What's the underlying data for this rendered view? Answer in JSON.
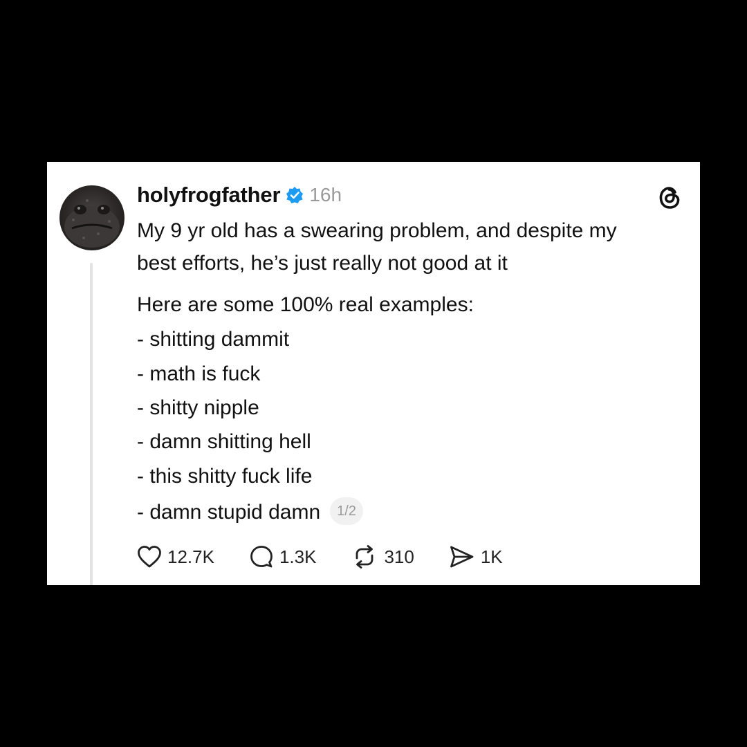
{
  "post": {
    "username": "holyfrogfather",
    "timestamp": "16h",
    "verified": true,
    "avatar_icon": "frog-avatar",
    "app_icon": "threads-logo-icon",
    "text_line1": "My 9 yr old has a swearing problem, and despite my",
    "text_line2": "best efforts, he’s just really not good at it",
    "intro": "Here are some 100% real examples:",
    "examples": [
      "- shitting dammit",
      "- math is fuck",
      "- shitty nipple",
      "- damn shitting hell",
      "- this shitty fuck life",
      "- damn stupid damn"
    ],
    "pager": "1/2"
  },
  "actions": {
    "likes": "12.7K",
    "replies": "1.3K",
    "reposts": "310",
    "shares": "1K"
  },
  "colors": {
    "background": "#000000",
    "card": "#ffffff",
    "text": "#111111",
    "muted": "#9a9a9a",
    "verified": "#1d9bf0"
  }
}
